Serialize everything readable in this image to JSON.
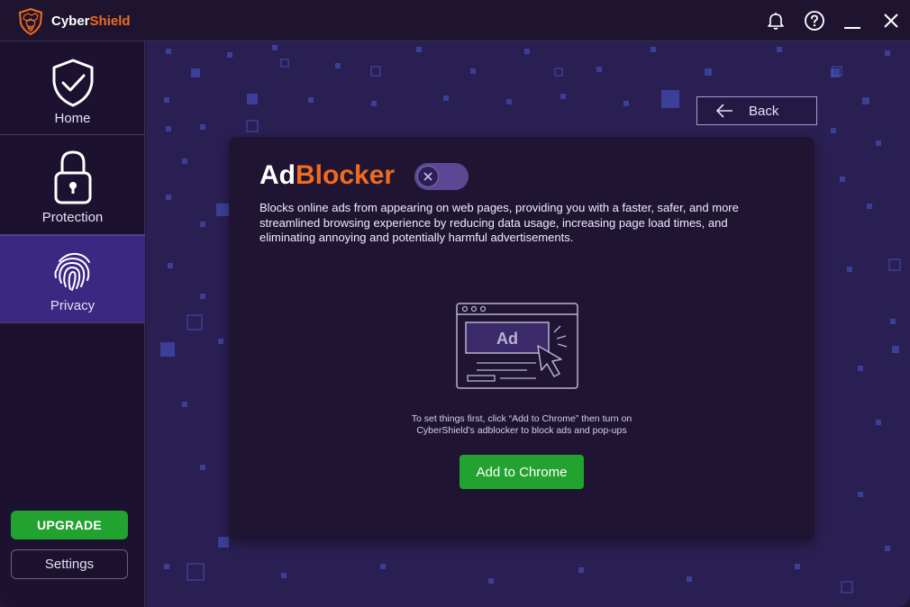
{
  "app": {
    "brand_part1": "Cyber",
    "brand_part2": "Shield",
    "accent_color": "#f26b1d",
    "icons": [
      "shield-logo-icon",
      "bell-icon",
      "help-icon",
      "minimize-icon",
      "close-icon"
    ]
  },
  "sidebar": {
    "items": [
      {
        "label": "Home",
        "icon": "shield-check-icon",
        "active": false
      },
      {
        "label": "Protection",
        "icon": "lock-icon",
        "active": false
      },
      {
        "label": "Privacy",
        "icon": "fingerprint-icon",
        "active": true
      }
    ],
    "upgrade_label": "UPGRADE",
    "settings_label": "Settings",
    "active_color": "#3b2883",
    "upgrade_color": "#22a22e"
  },
  "main": {
    "back_label": "Back",
    "card": {
      "title_part1": "Ad",
      "title_part2": "Blocker",
      "toggle_on": false,
      "description": "Blocks online ads from appearing on web pages, providing you with a faster, safer, and more streamlined browsing experience by reducing data usage, increasing page load times, and eliminating annoying and potentially harmful advertisements.",
      "illustration_label": "Ad",
      "hint_line1": "To set things first, click “Add to Chrome” then turn on",
      "hint_line2": "CyberShield’s adblocker to block  ads and pop-ups",
      "add_button_label": "Add to Chrome"
    }
  }
}
